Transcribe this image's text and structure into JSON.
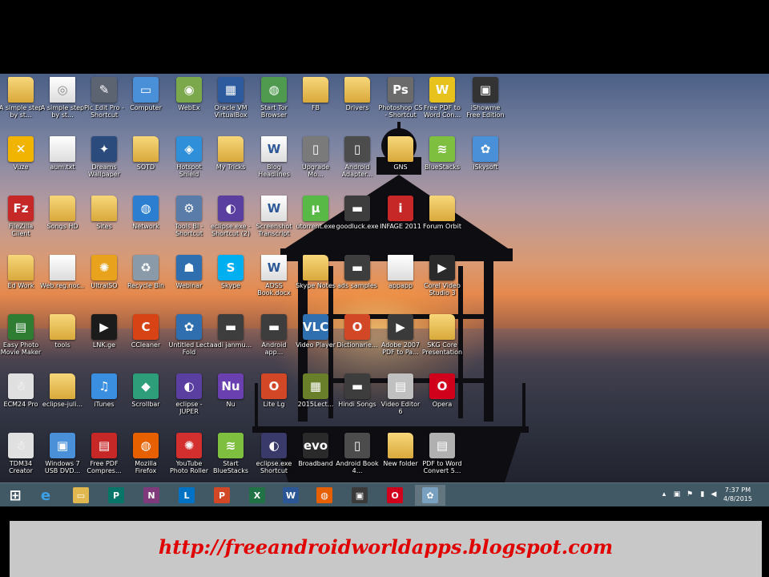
{
  "desktop": {
    "icons": [
      {
        "label": "A simple step by st...",
        "glyph": "",
        "color": "#e0b84f",
        "type": "folder",
        "icon": "folder-icon"
      },
      {
        "label": "A simple step by st...",
        "glyph": "◎",
        "color": "#ffffff",
        "type": "doc",
        "icon": "firefox-doc-icon"
      },
      {
        "label": "Pic Edit Pro - Shortcut",
        "glyph": "✎",
        "color": "#5b6470",
        "type": "app",
        "icon": "tools-icon"
      },
      {
        "label": "Computer",
        "glyph": "▭",
        "color": "#4a90d9",
        "type": "app",
        "icon": "computer-icon"
      },
      {
        "label": "WebEx",
        "glyph": "◉",
        "color": "#7aa84a",
        "type": "app",
        "icon": "eye-icon"
      },
      {
        "label": "Oracle VM VirtualBox",
        "glyph": "▦",
        "color": "#2e5a9e",
        "type": "app",
        "icon": "virtualbox-icon"
      },
      {
        "label": "Start Tor Browser",
        "glyph": "◍",
        "color": "#4f9a4f",
        "type": "app",
        "icon": "tor-icon"
      },
      {
        "label": "FB",
        "glyph": "",
        "color": "#e0b84f",
        "type": "folder",
        "icon": "folder-icon"
      },
      {
        "label": "Drivers",
        "glyph": "",
        "color": "#e0b84f",
        "type": "folder",
        "icon": "folder-icon"
      },
      {
        "label": "Photoshop CS - Shortcut",
        "glyph": "Ps",
        "color": "#6b6b6b",
        "type": "app",
        "icon": "photoshop-icon"
      },
      {
        "label": "Free PDF to Word Con...",
        "glyph": "W",
        "color": "#e8c21c",
        "type": "app",
        "icon": "pdf-word-icon"
      },
      {
        "label": "iShowme Free Edition",
        "glyph": "▣",
        "color": "#333333",
        "type": "app",
        "icon": "screen-icon"
      },
      {
        "label": "Vuze",
        "glyph": "✕",
        "color": "#f1b400",
        "type": "app",
        "icon": "vuze-icon"
      },
      {
        "label": "aum.txt",
        "glyph": "",
        "color": "#ffffff",
        "type": "doc",
        "icon": "text-file-icon"
      },
      {
        "label": "Dreams Wallpaper",
        "glyph": "✦",
        "color": "#2a4b7c",
        "type": "app",
        "icon": "wallpaper-icon"
      },
      {
        "label": "SOTD",
        "glyph": "",
        "color": "#e0b84f",
        "type": "folder",
        "icon": "folder-icon"
      },
      {
        "label": "Hotspot Shield",
        "glyph": "◈",
        "color": "#2f8fd9",
        "type": "app",
        "icon": "shield-icon"
      },
      {
        "label": "My Tricks",
        "glyph": "",
        "color": "#e0b84f",
        "type": "folder",
        "icon": "folder-icon"
      },
      {
        "label": "Blog Headlines",
        "glyph": "W",
        "color": "#2b5797",
        "type": "doc",
        "icon": "word-doc-icon"
      },
      {
        "label": "Upgrade Mo...",
        "glyph": "▯",
        "color": "#7a7a7a",
        "type": "app",
        "icon": "phone-icon"
      },
      {
        "label": "Android Adapter...",
        "glyph": "▯",
        "color": "#4c4c4c",
        "type": "app",
        "icon": "android-phone-icon"
      },
      {
        "label": "GNS",
        "glyph": "",
        "color": "#e0b84f",
        "type": "folder",
        "icon": "folder-icon"
      },
      {
        "label": "BlueStacks",
        "glyph": "≋",
        "color": "#7fbf3f",
        "type": "app",
        "icon": "bluestacks-icon"
      },
      {
        "label": "iSkysoft",
        "glyph": "✿",
        "color": "#4a90d9",
        "type": "app",
        "icon": "iskysoft-icon"
      },
      {
        "label": "FileZilla Client",
        "glyph": "Fz",
        "color": "#c62828",
        "type": "app",
        "icon": "filezilla-icon"
      },
      {
        "label": "Songs HD",
        "glyph": "",
        "color": "#e0b84f",
        "type": "folder",
        "icon": "folder-icon"
      },
      {
        "label": "Sites",
        "glyph": "",
        "color": "#e0b84f",
        "type": "folder",
        "icon": "folder-icon"
      },
      {
        "label": "Network",
        "glyph": "◍",
        "color": "#2c7fd0",
        "type": "app",
        "icon": "network-icon"
      },
      {
        "label": "Tools Bi - Shortcut",
        "glyph": "⚙",
        "color": "#5a7ca8",
        "type": "app",
        "icon": "tools-shortcut-icon"
      },
      {
        "label": "eclipse.exe - Shortcut (2)",
        "glyph": "◐",
        "color": "#5b3fa0",
        "type": "app",
        "icon": "eclipse-icon"
      },
      {
        "label": "Screenshot Transcript",
        "glyph": "W",
        "color": "#2b5797",
        "type": "doc",
        "icon": "word-doc-icon"
      },
      {
        "label": "utorrent.exe",
        "glyph": "µ",
        "color": "#58b947",
        "type": "app",
        "icon": "utorrent-icon"
      },
      {
        "label": "goodluck.exe",
        "glyph": "▬",
        "color": "#3d3d3d",
        "type": "app",
        "icon": "archive-icon"
      },
      {
        "label": "INFAGE 2011",
        "glyph": "i",
        "color": "#c62828",
        "type": "app",
        "icon": "infage-icon"
      },
      {
        "label": "Forum Orbit",
        "glyph": "",
        "color": "#e0b84f",
        "type": "folder",
        "icon": "folder-icon"
      },
      {
        "label": "Ed Work",
        "glyph": "",
        "color": "#e0b84f",
        "type": "folder",
        "icon": "folder-icon"
      },
      {
        "label": "Web.reg.noc...",
        "glyph": "",
        "color": "#ffffff",
        "type": "doc",
        "icon": "text-file-icon"
      },
      {
        "label": "UltraISO",
        "glyph": "✺",
        "color": "#e8a21c",
        "type": "app",
        "icon": "ultraiso-icon"
      },
      {
        "label": "Recycle Bin",
        "glyph": "♻",
        "color": "#8a9aa8",
        "type": "app",
        "icon": "recycle-bin-icon"
      },
      {
        "label": "Webinar",
        "glyph": "☗",
        "color": "#2f6fb0",
        "type": "app",
        "icon": "webinar-icon"
      },
      {
        "label": "Skype",
        "glyph": "S",
        "color": "#00aff0",
        "type": "app",
        "icon": "skype-icon"
      },
      {
        "label": "ADSS Book.docx",
        "glyph": "W",
        "color": "#2b5797",
        "type": "doc",
        "icon": "word-doc-icon"
      },
      {
        "label": "Skype Notes",
        "glyph": "",
        "color": "#e0b84f",
        "type": "folder",
        "icon": "folder-icon"
      },
      {
        "label": "ads samples",
        "glyph": "▬",
        "color": "#3d3d3d",
        "type": "app",
        "icon": "archive-icon"
      },
      {
        "label": "appapp",
        "glyph": "",
        "color": "#ffffff",
        "type": "doc",
        "icon": "text-file-icon"
      },
      {
        "label": "Corel Video Studio 3",
        "glyph": "▶",
        "color": "#2a2a2a",
        "type": "app",
        "icon": "video-icon"
      },
      {
        "label": "Easy Photo Movie Maker",
        "glyph": "▤",
        "color": "#2e7d32",
        "type": "app",
        "icon": "movie-maker-icon"
      },
      {
        "label": "tools",
        "glyph": "",
        "color": "#e0b84f",
        "type": "folder",
        "icon": "folder-icon"
      },
      {
        "label": "LNK.ge",
        "glyph": "▶",
        "color": "#1b1b1b",
        "type": "app",
        "icon": "media-icon"
      },
      {
        "label": "CCleaner",
        "glyph": "C",
        "color": "#d84315",
        "type": "app",
        "icon": "ccleaner-icon"
      },
      {
        "label": "Untitled Lect Fold",
        "glyph": "✿",
        "color": "#2f6fb0",
        "type": "app",
        "icon": "lecture-icon"
      },
      {
        "label": "aadi janmu...",
        "glyph": "▬",
        "color": "#3d3d3d",
        "type": "app",
        "icon": "archive-icon"
      },
      {
        "label": "Android app...",
        "glyph": "▬",
        "color": "#3d3d3d",
        "type": "app",
        "icon": "archive-icon"
      },
      {
        "label": "Video Player",
        "glyph": "VLC",
        "color": "#2f6fb0",
        "type": "app",
        "icon": "video-player-icon"
      },
      {
        "label": "Dictionarie...",
        "glyph": "O",
        "color": "#d24726",
        "type": "app",
        "icon": "office-icon"
      },
      {
        "label": "Adobe 2007 PDF to Pa...",
        "glyph": "▶",
        "color": "#3a3a3a",
        "type": "app",
        "icon": "adobe-icon"
      },
      {
        "label": "SKG Core Presentation",
        "glyph": "",
        "color": "#e0b84f",
        "type": "folder",
        "icon": "folder-icon"
      },
      {
        "label": "ECM24 Pro",
        "glyph": "☃",
        "color": "#e0e0e0",
        "type": "app",
        "icon": "cleaner-icon"
      },
      {
        "label": "eclipse-juli...",
        "glyph": "",
        "color": "#e0b84f",
        "type": "folder",
        "icon": "folder-icon"
      },
      {
        "label": "iTunes",
        "glyph": "♫",
        "color": "#3b8fe0",
        "type": "app",
        "icon": "itunes-icon"
      },
      {
        "label": "Scrollbar",
        "glyph": "◆",
        "color": "#2e9e7a",
        "type": "app",
        "icon": "scrollbar-icon"
      },
      {
        "label": "eclipse - JUPER",
        "glyph": "◐",
        "color": "#5b3fa0",
        "type": "app",
        "icon": "eclipse-icon"
      },
      {
        "label": "Nu",
        "glyph": "Nu",
        "color": "#6a3fb0",
        "type": "app",
        "icon": "nu-icon"
      },
      {
        "label": "Lite Lg",
        "glyph": "O",
        "color": "#d24726",
        "type": "app",
        "icon": "office-icon"
      },
      {
        "label": "2015Lect...",
        "glyph": "▦",
        "color": "#6a7f2a",
        "type": "app",
        "icon": "image-icon"
      },
      {
        "label": "Hindi Songs",
        "glyph": "▬",
        "color": "#3d3d3d",
        "type": "app",
        "icon": "archive-icon"
      },
      {
        "label": "Video Editor 6",
        "glyph": "▤",
        "color": "#c0c0c0",
        "type": "app",
        "icon": "video-editor-icon"
      },
      {
        "label": "Opera",
        "glyph": "O",
        "color": "#d0021b",
        "type": "app",
        "icon": "opera-icon"
      },
      {
        "label": "TDM34 Creator",
        "glyph": "☃",
        "color": "#e0e0e0",
        "type": "app",
        "icon": "creator-icon"
      },
      {
        "label": "Windows 7 USB DVD...",
        "glyph": "▣",
        "color": "#4a90d9",
        "type": "app",
        "icon": "usb-dvd-icon"
      },
      {
        "label": "Free PDF Compres...",
        "glyph": "▤",
        "color": "#c62828",
        "type": "app",
        "icon": "pdf-icon"
      },
      {
        "label": "Mozilla Firefox",
        "glyph": "◍",
        "color": "#e66000",
        "type": "app",
        "icon": "firefox-icon"
      },
      {
        "label": "YouTube Photo Roller",
        "glyph": "✺",
        "color": "#d32f2f",
        "type": "app",
        "icon": "photo-roller-icon"
      },
      {
        "label": "Start BlueStacks",
        "glyph": "≋",
        "color": "#7fbf3f",
        "type": "app",
        "icon": "bluestacks-icon"
      },
      {
        "label": "eclipse.exe Shortcut",
        "glyph": "◐",
        "color": "#3a3a6a",
        "type": "app",
        "icon": "eclipse-icon"
      },
      {
        "label": "Broadband",
        "glyph": "evo",
        "color": "#2a2a2a",
        "type": "app",
        "icon": "broadband-icon"
      },
      {
        "label": "Android Book 4...",
        "glyph": "▯",
        "color": "#4c4c4c",
        "type": "app",
        "icon": "android-book-icon"
      },
      {
        "label": "New folder",
        "glyph": "",
        "color": "#e0b84f",
        "type": "folder",
        "icon": "folder-icon"
      },
      {
        "label": "PDF to Word Convert 5...",
        "glyph": "▤",
        "color": "#b0b0b0",
        "type": "app",
        "icon": "pdf-convert-icon"
      }
    ]
  },
  "taskbar": {
    "items": [
      {
        "name": "start-button",
        "glyph": "⊞",
        "color": "transparent",
        "icon": "windows-icon"
      },
      {
        "name": "taskbar-ie",
        "glyph": "e",
        "color": "transparent",
        "icon": "internet-explorer-icon"
      },
      {
        "name": "taskbar-explorer",
        "glyph": "▭",
        "color": "#e0b84f",
        "icon": "file-explorer-icon"
      },
      {
        "name": "taskbar-publisher",
        "glyph": "P",
        "color": "#077568",
        "icon": "publisher-icon"
      },
      {
        "name": "taskbar-onenote",
        "glyph": "N",
        "color": "#80397b",
        "icon": "onenote-icon"
      },
      {
        "name": "taskbar-lync",
        "glyph": "L",
        "color": "#0072c6",
        "icon": "lync-icon"
      },
      {
        "name": "taskbar-powerpoint",
        "glyph": "P",
        "color": "#d24726",
        "icon": "powerpoint-icon"
      },
      {
        "name": "taskbar-excel",
        "glyph": "X",
        "color": "#217346",
        "icon": "excel-icon"
      },
      {
        "name": "taskbar-word",
        "glyph": "W",
        "color": "#2b5797",
        "icon": "word-icon"
      },
      {
        "name": "taskbar-firefox",
        "glyph": "◍",
        "color": "#e66000",
        "icon": "firefox-icon"
      },
      {
        "name": "taskbar-app",
        "glyph": "▣",
        "color": "#3a3a3a",
        "icon": "app-icon"
      },
      {
        "name": "taskbar-opera",
        "glyph": "O",
        "color": "#d0021b",
        "icon": "opera-icon"
      },
      {
        "name": "taskbar-active",
        "glyph": "✿",
        "color": "#7aa0c0",
        "icon": "active-app-icon"
      }
    ],
    "clock": {
      "time": "7:37 PM",
      "date": "4/8/2015"
    }
  },
  "banner": {
    "url": "http://freeandroidworldapps.blogspot.com"
  }
}
